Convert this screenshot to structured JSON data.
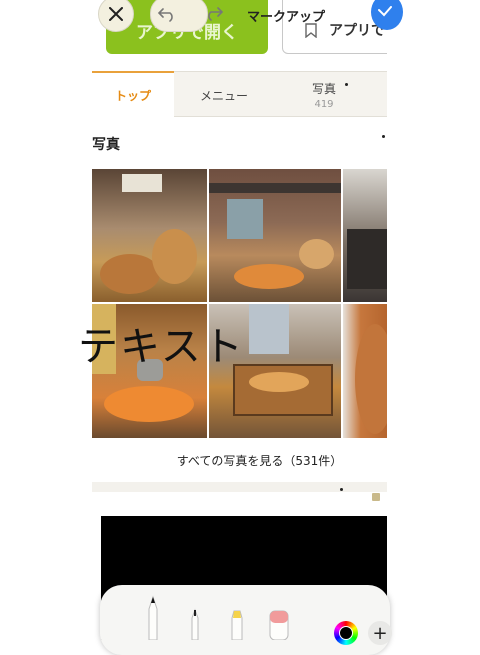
{
  "markup": {
    "title": "マークアップ",
    "added_text": "テキスト",
    "tools": [
      "pen",
      "fineliner",
      "highlighter",
      "eraser"
    ]
  },
  "app_buttons": {
    "open_app": "アプリで開く",
    "second": "アプリで"
  },
  "tabs": [
    {
      "label": "トップ",
      "active": true
    },
    {
      "label": "メニュー",
      "active": false
    },
    {
      "label": "写真",
      "count": "419",
      "active": false
    }
  ],
  "photos_section": {
    "title": "写真",
    "see_all": "すべての写真を見る（531件）"
  },
  "colors": {
    "accent": "#e58b14",
    "open_app_green": "#8bc11e",
    "done_blue": "#2f80ed",
    "selected_color": "#000000"
  }
}
